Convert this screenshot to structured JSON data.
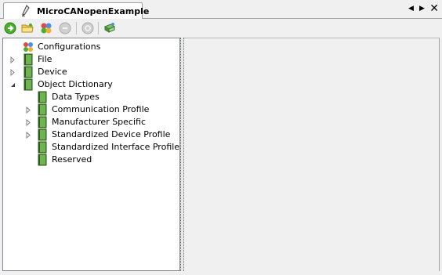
{
  "tab": {
    "title": "MicroCANopenExample"
  },
  "tree": {
    "root_label": "Configurations",
    "items": [
      {
        "label": "File",
        "expanded": false
      },
      {
        "label": "Device",
        "expanded": false
      },
      {
        "label": "Object Dictionary",
        "expanded": true,
        "children": [
          {
            "label": "Data Types",
            "has_children": false
          },
          {
            "label": "Communication Profile",
            "has_children": true
          },
          {
            "label": "Manufacturer Specific",
            "has_children": true
          },
          {
            "label": "Standardized Device Profile",
            "has_children": true
          },
          {
            "label": "Standardized Interface Profile",
            "has_children": false
          },
          {
            "label": "Reserved",
            "has_children": false
          }
        ]
      }
    ]
  },
  "toolbar_icons": [
    "go-forward-icon",
    "open-folder-icon",
    "configure-icon",
    "disabled-stop-icon",
    "disabled-refresh-icon",
    "export-icon"
  ],
  "colors": {
    "tab_bg": "#ffffff",
    "pane_bg": "#f0f0f0",
    "book_green": "#4f8f3a"
  }
}
